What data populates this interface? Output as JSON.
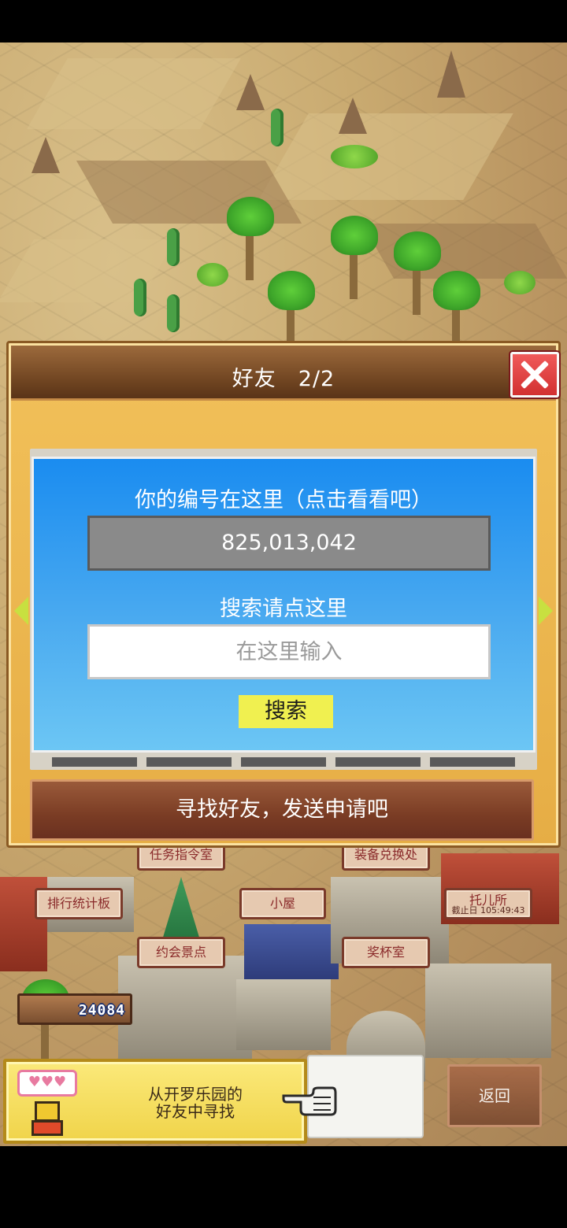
{
  "dialog": {
    "title": "好友　2/2"
  },
  "friend_panel": {
    "id_label": "你的编号在这里（点击看看吧）",
    "id_value": "825,013,042",
    "search_label": "搜索请点这里",
    "search_placeholder": "在这里输入",
    "search_button": "搜索"
  },
  "find_friends_button": "寻找好友，发送申请吧",
  "town": {
    "signs": [
      {
        "label": "任务指令室"
      },
      {
        "label": "装备兑换处"
      },
      {
        "label": "排行统计板"
      },
      {
        "label": "小屋"
      },
      {
        "label": "托儿所",
        "sub": "截止日 105:49:43"
      },
      {
        "label": "约会景点"
      },
      {
        "label": "奖杯室"
      }
    ],
    "score": "24084"
  },
  "bottom": {
    "cairo_friends_line1": "从开罗乐园的",
    "cairo_friends_line2": "好友中寻找",
    "hearts": "♥♥♥",
    "back_button": "返回"
  },
  "colors": {
    "panel_blue": "#1a8cf0",
    "dialog_gold": "#f2c15a",
    "header_brown": "#6e4320",
    "close_red": "#d23030",
    "search_yellow": "#f0f050"
  },
  "icons": {
    "close": "close-icon",
    "prev": "arrow-left-icon",
    "next": "arrow-right-icon",
    "hand": "pointing-hand-icon",
    "mascot": "kairobot-icon"
  }
}
